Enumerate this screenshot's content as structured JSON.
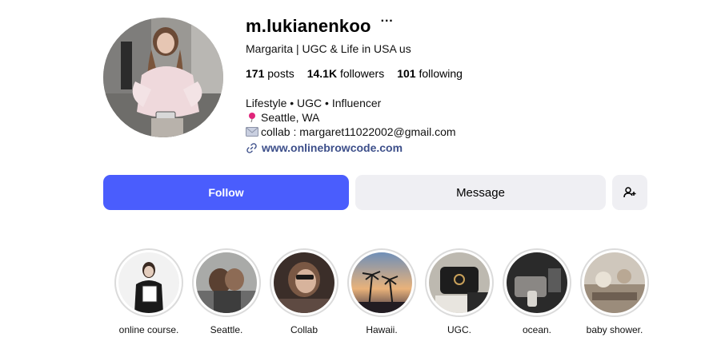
{
  "profile": {
    "username": "m.lukianenkoo",
    "more_icon": "···",
    "full_name": "Margarita | UGC & Life in USA us",
    "stats": [
      {
        "value": "171",
        "label": "posts"
      },
      {
        "value": "14.1K",
        "label": "followers"
      },
      {
        "value": "101",
        "label": "following"
      }
    ],
    "bio": {
      "line1": "Lifestyle • UGC • Influencer",
      "location": "Seattle, WA",
      "email": "collab : margaret11022002@gmail.com"
    },
    "link": "www.onlinebrowcode.com"
  },
  "actions": {
    "follow": "Follow",
    "message": "Message"
  },
  "highlights": [
    {
      "label": "online course."
    },
    {
      "label": "Seattle."
    },
    {
      "label": "Collab"
    },
    {
      "label": "Hawaii."
    },
    {
      "label": "UGC."
    },
    {
      "label": "ocean."
    },
    {
      "label": "baby shower."
    }
  ],
  "colors": {
    "follow_button": "#4a5dfd",
    "secondary_button": "#efeff3",
    "link": "#3d4f8a",
    "ring": "#dbdbdb"
  }
}
